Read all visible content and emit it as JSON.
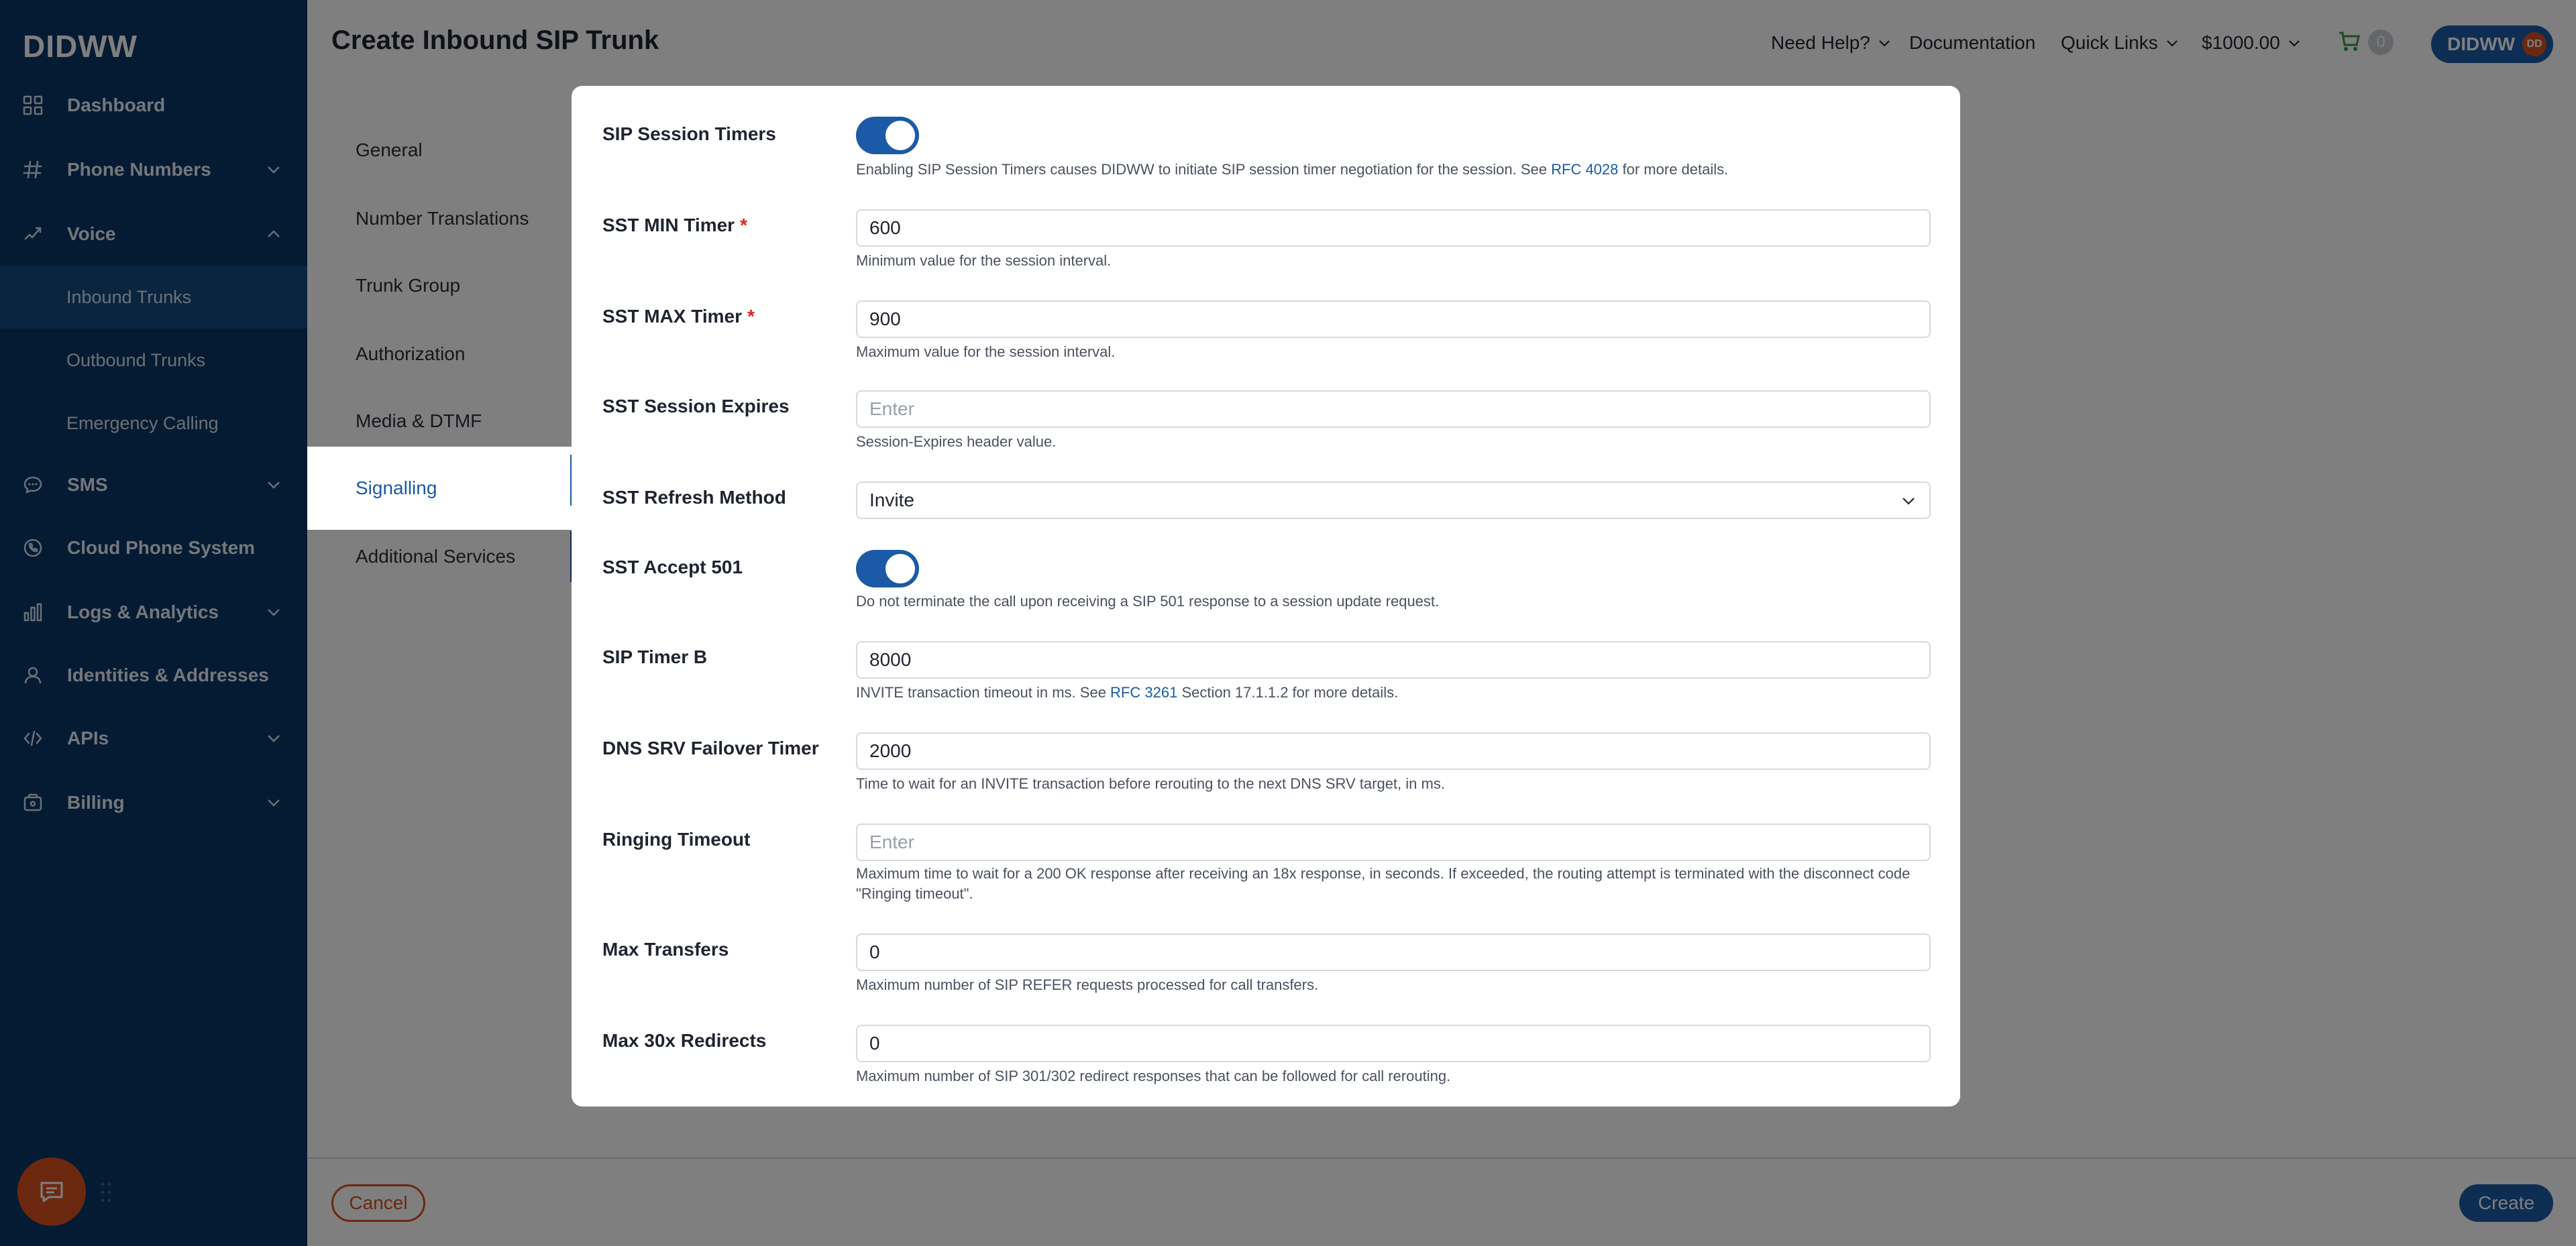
{
  "app": {
    "logo": "DIDWW"
  },
  "sidebar": {
    "items": [
      {
        "label": "Dashboard",
        "icon": "grid-icon",
        "has_chevron": false
      },
      {
        "label": "Phone Numbers",
        "icon": "hash-icon",
        "has_chevron": true
      },
      {
        "label": "Voice",
        "icon": "voice-icon",
        "has_chevron": true,
        "expanded": true
      },
      {
        "label": "SMS",
        "icon": "chat-bubble-icon",
        "has_chevron": true
      },
      {
        "label": "Cloud Phone System",
        "icon": "phone-icon",
        "has_chevron": false
      },
      {
        "label": "Logs & Analytics",
        "icon": "bar-chart-icon",
        "has_chevron": true
      },
      {
        "label": "Identities & Addresses",
        "icon": "person-icon",
        "has_chevron": false
      },
      {
        "label": "APIs",
        "icon": "code-icon",
        "has_chevron": true
      },
      {
        "label": "Billing",
        "icon": "wallet-icon",
        "has_chevron": true
      }
    ],
    "voice_sub": [
      {
        "label": "Inbound Trunks",
        "active": true
      },
      {
        "label": "Outbound Trunks",
        "active": false
      },
      {
        "label": "Emergency Calling",
        "active": false
      }
    ]
  },
  "header": {
    "title": "Create Inbound SIP Trunk",
    "need_help": "Need Help?",
    "documentation": "Documentation",
    "quick_links": "Quick Links",
    "balance": "$1000.00",
    "cart_count": "0",
    "user_name": "DIDWW",
    "user_initials": "DD"
  },
  "tabs": [
    {
      "label": "General"
    },
    {
      "label": "Number Translations"
    },
    {
      "label": "Trunk Group"
    },
    {
      "label": "Authorization"
    },
    {
      "label": "Media & DTMF"
    },
    {
      "label": "Signalling",
      "active": true
    },
    {
      "label": "Additional Services"
    }
  ],
  "footer": {
    "cancel": "Cancel",
    "create": "Create"
  },
  "form": {
    "sip_session_timers": {
      "label": "SIP Session Timers",
      "enabled": true,
      "help_before": "Enabling SIP Session Timers causes DIDWW to initiate SIP session timer negotiation for the session. See ",
      "help_link": "RFC 4028",
      "help_after": " for more details."
    },
    "sst_min_timer": {
      "label": "SST MIN Timer",
      "required": "*",
      "value": "600",
      "help": "Minimum value for the session interval."
    },
    "sst_max_timer": {
      "label": "SST MAX Timer",
      "required": "*",
      "value": "900",
      "help": "Maximum value for the session interval."
    },
    "sst_session_expires": {
      "label": "SST Session Expires",
      "value": "",
      "placeholder": "Enter",
      "help": "Session-Expires header value."
    },
    "sst_refresh_method": {
      "label": "SST Refresh Method",
      "value": "Invite"
    },
    "sst_accept_501": {
      "label": "SST Accept 501",
      "enabled": true,
      "help": "Do not terminate the call upon receiving a SIP 501 response to a session update request."
    },
    "sip_timer_b": {
      "label": "SIP Timer B",
      "value": "8000",
      "help_before": "INVITE transaction timeout in ms. See ",
      "help_link": "RFC 3261",
      "help_after": " Section 17.1.1.2 for more details."
    },
    "dns_srv_failover_timer": {
      "label": "DNS SRV Failover Timer",
      "value": "2000",
      "help": "Time to wait for an INVITE transaction before rerouting to the next DNS SRV target, in ms."
    },
    "ringing_timeout": {
      "label": "Ringing Timeout",
      "value": "",
      "placeholder": "Enter",
      "help": "Maximum time to wait for a 200 OK response after receiving an 18x response, in seconds. If exceeded, the routing attempt is terminated with the disconnect code \"Ringing timeout\"."
    },
    "max_transfers": {
      "label": "Max Transfers",
      "value": "0",
      "help": "Maximum number of SIP REFER requests processed for call transfers."
    },
    "max_30x_redirects": {
      "label": "Max 30x Redirects",
      "value": "0",
      "help": "Maximum number of SIP 301/302 redirect responses that can be followed for call rerouting."
    }
  },
  "colors": {
    "sidebar_bg": "#0b3666",
    "sidebar_active": "#124b80",
    "accent": "#1a5aa6",
    "danger": "#d9501e",
    "cart_green": "#2e9b3e"
  }
}
